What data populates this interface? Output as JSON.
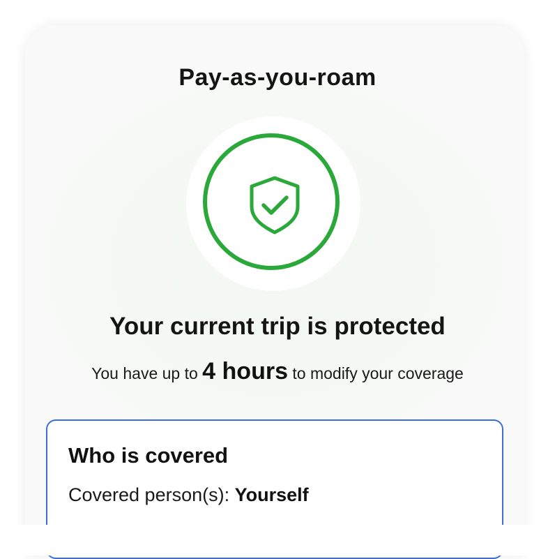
{
  "header": {
    "title": "Pay-as-you-roam"
  },
  "status": {
    "icon": "shield-check-icon",
    "accent_color": "#2aa83a",
    "headline": "Your current trip is protected",
    "sub_prefix": "You have up to",
    "sub_highlight": "4 hours",
    "sub_suffix": "to modify your coverage"
  },
  "coverage": {
    "title": "Who is covered",
    "label": "Covered person(s):",
    "value": "Yourself",
    "border_color": "#3b6fd6"
  }
}
